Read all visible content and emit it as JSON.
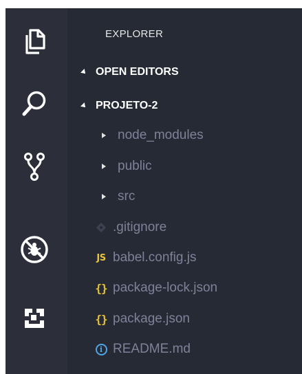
{
  "activity_bar": {
    "icons": [
      "explorer-icon",
      "search-icon",
      "source-control-icon",
      "debug-icon",
      "extensions-icon"
    ]
  },
  "sidebar": {
    "title": "EXPLORER",
    "sections": [
      {
        "label": "OPEN EDITORS"
      },
      {
        "label": "PROJETO-2"
      }
    ],
    "folders": [
      {
        "label": "node_modules"
      },
      {
        "label": "public"
      },
      {
        "label": "src"
      }
    ],
    "files": [
      {
        "label": ".gitignore",
        "icon": "git-file-icon"
      },
      {
        "label": "babel.config.js",
        "icon": "js-file-icon",
        "badge": "JS"
      },
      {
        "label": "package-lock.json",
        "icon": "json-file-icon",
        "badge": "{}"
      },
      {
        "label": "package.json",
        "icon": "json-file-icon",
        "badge": "{}"
      },
      {
        "label": "README.md",
        "icon": "info-file-icon",
        "badge": "i"
      }
    ]
  },
  "colors": {
    "activity_bar_bg": "#2c2f3a",
    "sidebar_bg": "#262a35",
    "tree_text": "#7e8299",
    "accent_yellow": "#e8c53c",
    "accent_blue": "#4fa6e6"
  }
}
